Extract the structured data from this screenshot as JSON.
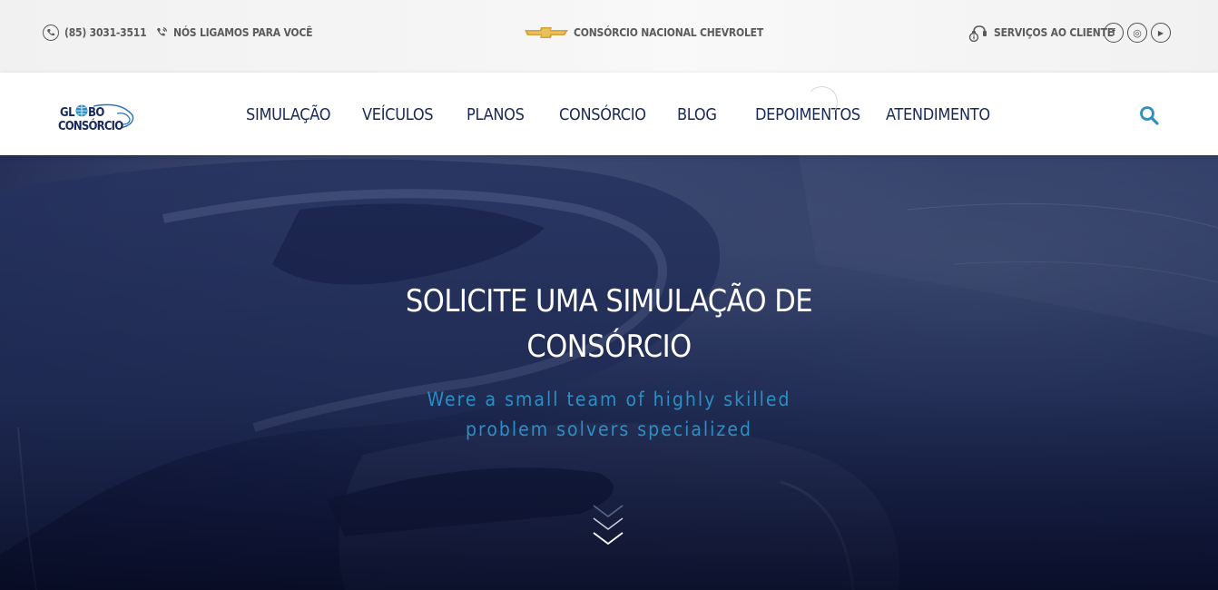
{
  "topbar": {
    "phone": "(85) 3031-3511",
    "callback": "NÓS LIGAMOS PARA VOCÊ",
    "brand": "CONSÓRCIO NACIONAL CHEVROLET",
    "services": "SERVIÇOS AO CLIENTE",
    "socials": [
      {
        "icon": "facebook-icon",
        "glyph": "f"
      },
      {
        "icon": "instagram-icon",
        "glyph": "◎"
      },
      {
        "icon": "youtube-icon",
        "glyph": "▶"
      }
    ]
  },
  "logo": {
    "line1": "GL",
    "line1b": "BO",
    "line2": "CONSÓRCIO"
  },
  "nav": {
    "items": [
      "SIMULAÇÃO",
      "VEÍCULOS",
      "PLANOS",
      "CONSÓRCIO",
      "BLOG",
      "DEPOIMENTOS",
      "ATENDIMENTO"
    ]
  },
  "hero": {
    "title_line1": "SOLICITE UMA SIMULAÇÃO DE",
    "title_line2": "CONSÓRCIO",
    "subtitle_line1": "Were a small team of highly skilled",
    "subtitle_line2": "problem solvers specialized"
  },
  "colors": {
    "nav_text": "#17285a",
    "accent": "#2b8fc3",
    "topbar_bg": "#f1f1f1",
    "hero_bg": "#1a2450"
  }
}
